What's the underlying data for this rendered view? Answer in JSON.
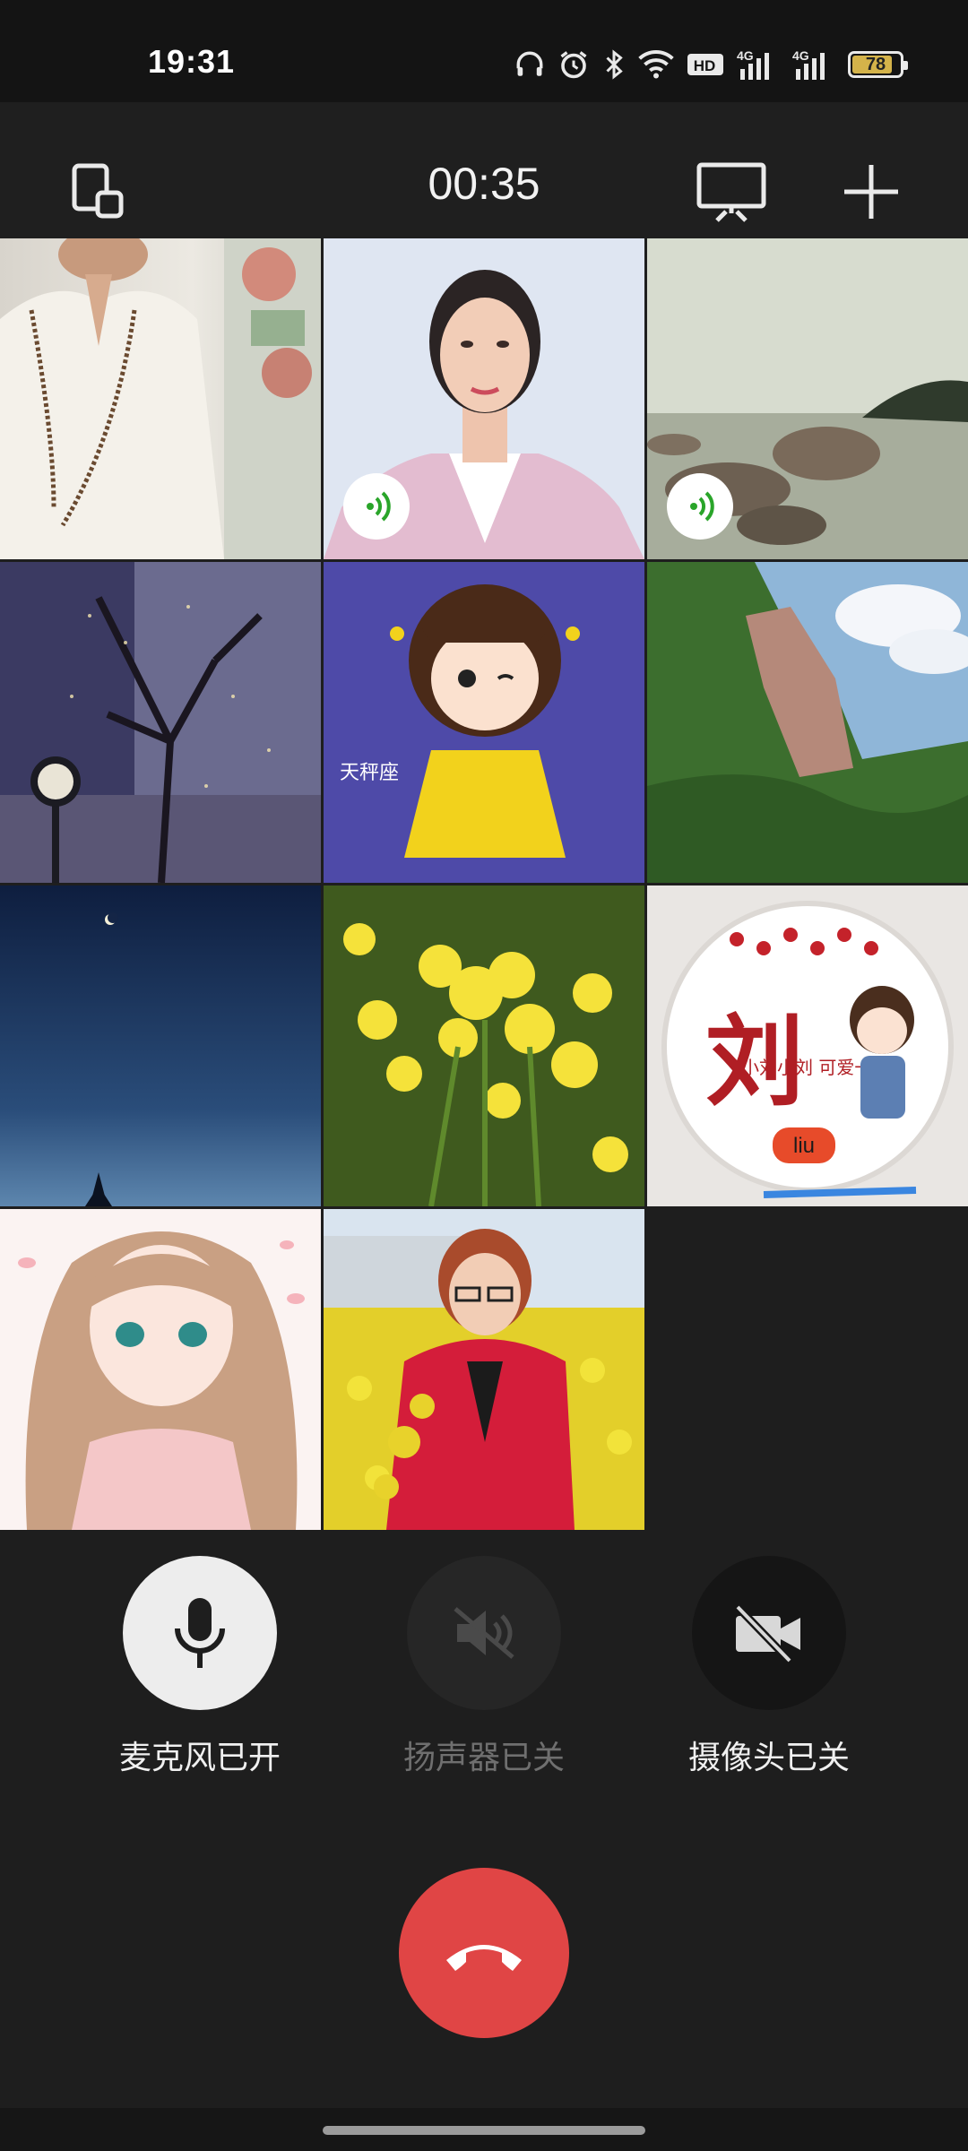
{
  "status_bar": {
    "time": "19:31",
    "battery": "78",
    "icons": [
      "headphones-icon",
      "alarm-icon",
      "bluetooth-icon",
      "wifi-icon",
      "hd-icon",
      "4g-signal-icon",
      "4g-signal-icon",
      "battery-icon"
    ],
    "hd_label": "HD",
    "net_label_1": "4G",
    "net_label_2": "4G"
  },
  "top_bar": {
    "timer": "00:35",
    "left_button_icon": "switch-window-icon",
    "right_buttons": [
      "screen-share-icon",
      "add-icon"
    ]
  },
  "grid": {
    "tiles": [
      {
        "name": "participant-1",
        "speaking": false
      },
      {
        "name": "participant-2",
        "speaking": true
      },
      {
        "name": "participant-3",
        "speaking": true
      },
      {
        "name": "participant-4",
        "speaking": false
      },
      {
        "name": "participant-5",
        "speaking": false
      },
      {
        "name": "participant-6",
        "speaking": false
      },
      {
        "name": "participant-7",
        "speaking": false
      },
      {
        "name": "participant-8",
        "speaking": false
      },
      {
        "name": "participant-9",
        "speaking": false
      },
      {
        "name": "participant-10",
        "speaking": false
      },
      {
        "name": "participant-11",
        "speaking": false
      }
    ],
    "avatar_texts": {
      "cartoon_badge": "天秤座",
      "liu_big": "刘",
      "liu_line": "小刘小刘 可爱一流",
      "liu_small": "liu"
    }
  },
  "controls": {
    "mic_label": "麦克风已开",
    "speaker_label": "扬声器已关",
    "camera_label": "摄像头已关"
  },
  "colors": {
    "background": "#1e1e1e",
    "hangup": "#e04545",
    "speaking_green": "#2aa52a"
  }
}
